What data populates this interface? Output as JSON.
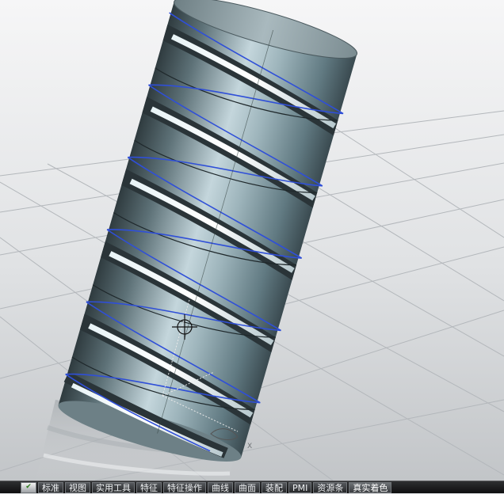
{
  "viewport": {
    "axis_label": "X"
  },
  "taskbar": {
    "start_icon": "nx-app-icon",
    "tabs": [
      {
        "label": "标准"
      },
      {
        "label": "视图"
      },
      {
        "label": "实用工具"
      },
      {
        "label": "特征"
      },
      {
        "label": "特征操作"
      },
      {
        "label": "曲线"
      },
      {
        "label": "曲面"
      },
      {
        "label": "装配"
      },
      {
        "label": "PMI"
      },
      {
        "label": "资源条"
      },
      {
        "label": "真实着色"
      }
    ],
    "active_tab": "真实着色"
  },
  "colors": {
    "background_top": "#f4f5f6",
    "background_bottom": "#c3c6c9",
    "grid": "#b4b8bc",
    "model_body": "#8fa8b0",
    "helix": "#2f4fd8"
  }
}
